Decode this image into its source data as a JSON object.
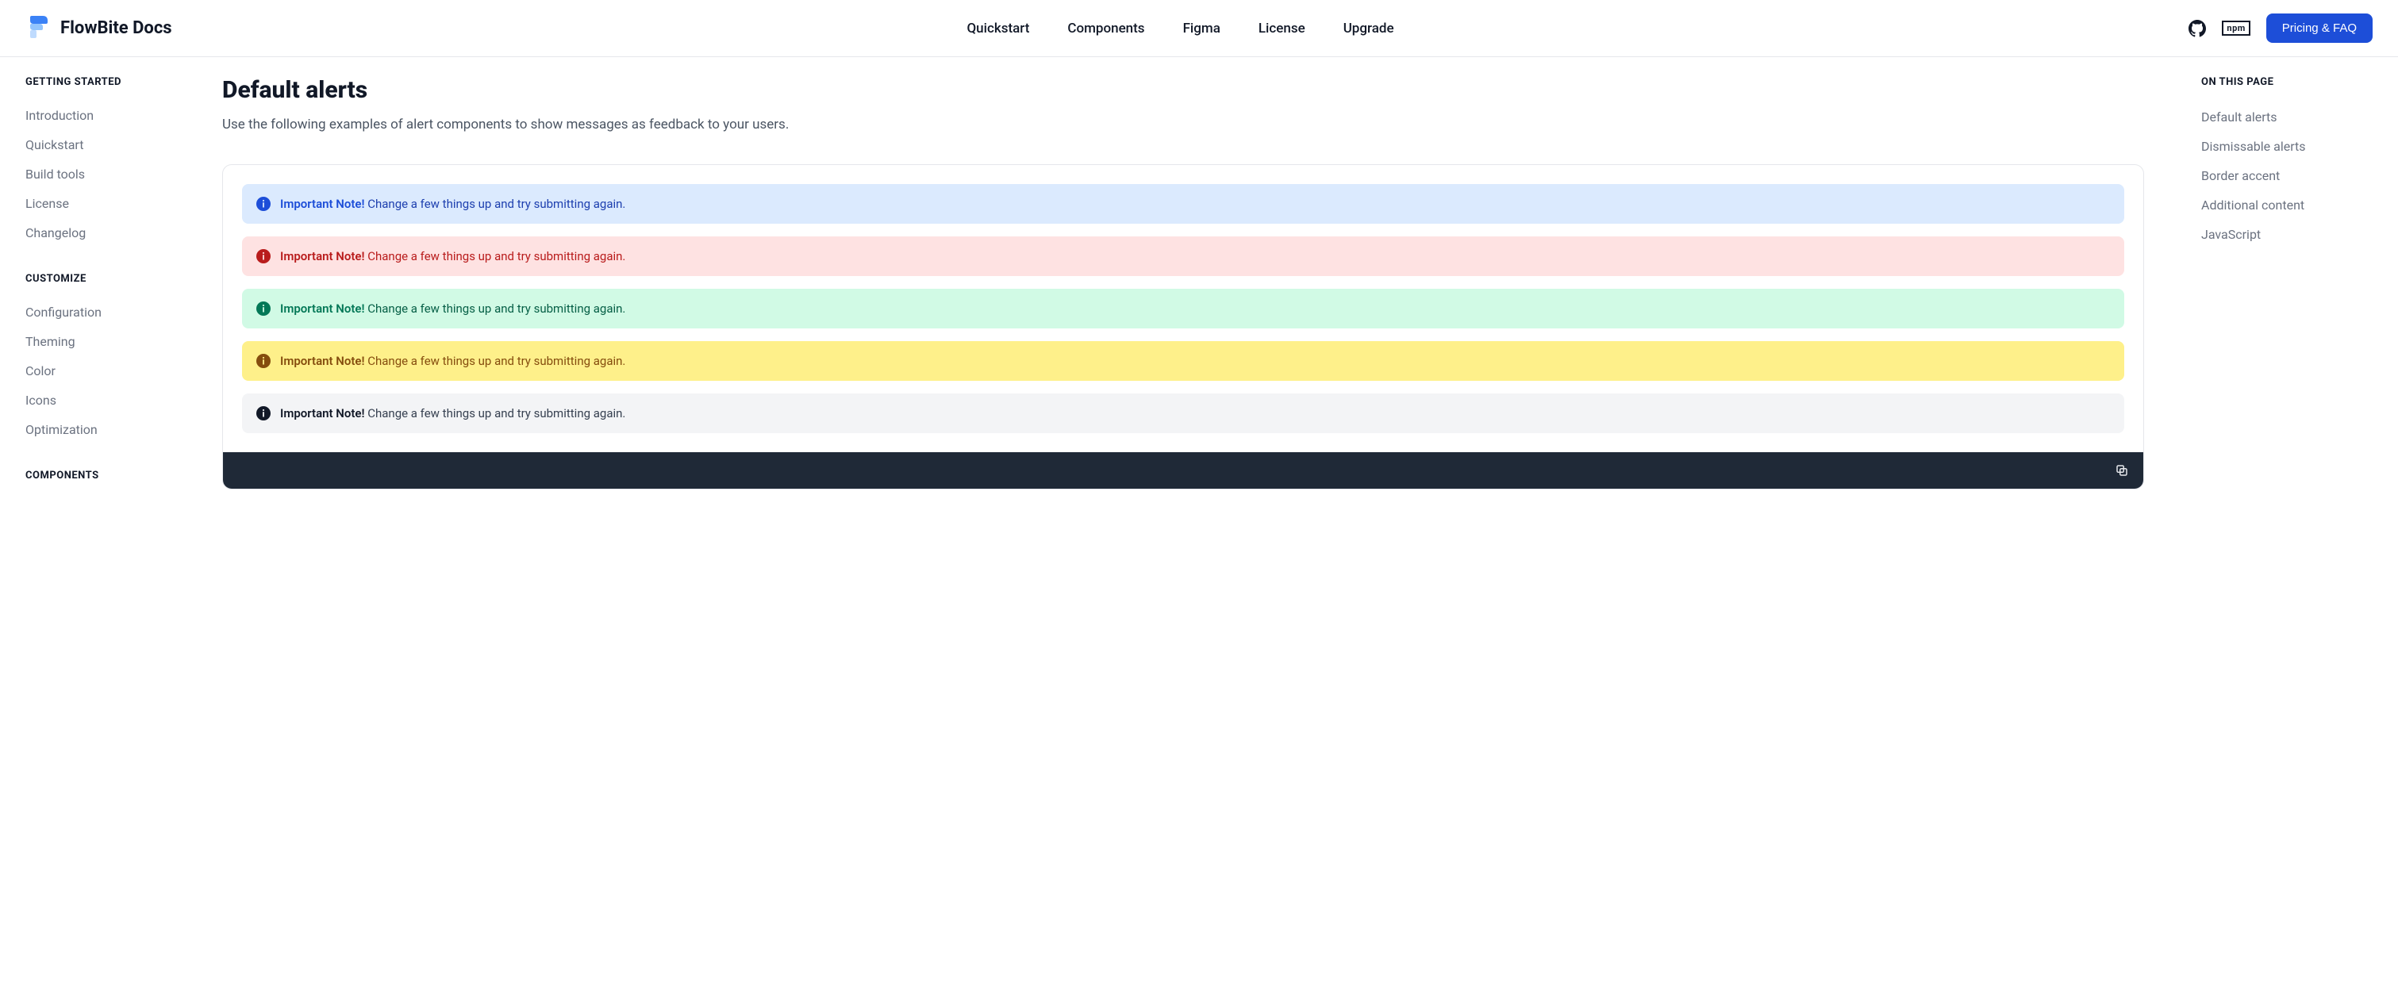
{
  "brand": {
    "name": "FlowBite Docs"
  },
  "nav": {
    "links": [
      "Quickstart",
      "Components",
      "Figma",
      "License",
      "Upgrade"
    ],
    "npm_label": "npm",
    "cta": "Pricing & FAQ"
  },
  "sidebar": {
    "sections": [
      {
        "title": "GETTING STARTED",
        "items": [
          "Introduction",
          "Quickstart",
          "Build tools",
          "License",
          "Changelog"
        ]
      },
      {
        "title": "CUSTOMIZE",
        "items": [
          "Configuration",
          "Theming",
          "Color",
          "Icons",
          "Optimization"
        ]
      },
      {
        "title": "COMPONENTS",
        "items": []
      }
    ]
  },
  "page": {
    "title": "Default alerts",
    "description": "Use the following examples of alert components to show messages as feedback to your users."
  },
  "alerts": [
    {
      "variant": "blue",
      "strong": "Important Note!",
      "text": " Change a few things up and try submitting again."
    },
    {
      "variant": "red",
      "strong": "Important Note!",
      "text": " Change a few things up and try submitting again."
    },
    {
      "variant": "green",
      "strong": "Important Note!",
      "text": " Change a few things up and try submitting again."
    },
    {
      "variant": "yellow",
      "strong": "Important Note!",
      "text": " Change a few things up and try submitting again."
    },
    {
      "variant": "gray",
      "strong": "Important Note!",
      "text": " Change a few things up and try submitting again."
    }
  ],
  "toc": {
    "title": "ON THIS PAGE",
    "items": [
      "Default alerts",
      "Dismissable alerts",
      "Border accent",
      "Additional content",
      "JavaScript"
    ]
  }
}
